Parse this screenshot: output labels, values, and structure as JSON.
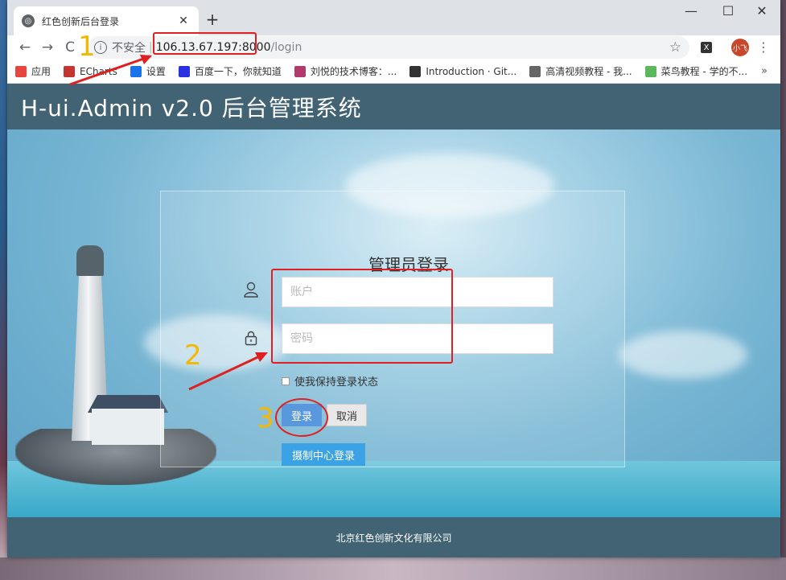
{
  "browser": {
    "tab_title": "红色创新后台登录",
    "tab_close": "✕",
    "new_tab": "+",
    "window_controls": [
      "—",
      "☐",
      "✕"
    ],
    "nav": {
      "back": "←",
      "forward": "→",
      "reload": "C"
    },
    "address": {
      "insecure_label": "不安全",
      "host": "106.13.67.197:8000",
      "path": "/login"
    },
    "avatar_text": "小飞",
    "ext_label": "X",
    "bookmarks": [
      {
        "label": "应用",
        "color": "#e8453c"
      },
      {
        "label": "ECharts",
        "color": "#c23531"
      },
      {
        "label": "设置",
        "color": "#1a73e8"
      },
      {
        "label": "百度一下，你就知道",
        "color": "#2932e1"
      },
      {
        "label": "刘悦的技术博客：...",
        "color": "#b03a6a"
      },
      {
        "label": "Introduction · Git...",
        "color": "#333333"
      },
      {
        "label": "高清视频教程 - 我...",
        "color": "#666666"
      },
      {
        "label": "菜鸟教程 - 学的不...",
        "color": "#5cb85c"
      }
    ],
    "bookmarks_more": "»"
  },
  "page": {
    "header_title": "H-ui.Admin v2.0 后台管理系统",
    "login": {
      "title": "管理员登录",
      "account_placeholder": "账户",
      "password_placeholder": "密码",
      "remember_label": "使我保持登录状态",
      "login_button": "登录",
      "cancel_button": "取消",
      "center_login_button": "摄制中心登录"
    },
    "footer_text": "北京红色创新文化有限公司"
  },
  "annotations": {
    "n1": "1",
    "n2": "2",
    "n3": "3"
  }
}
